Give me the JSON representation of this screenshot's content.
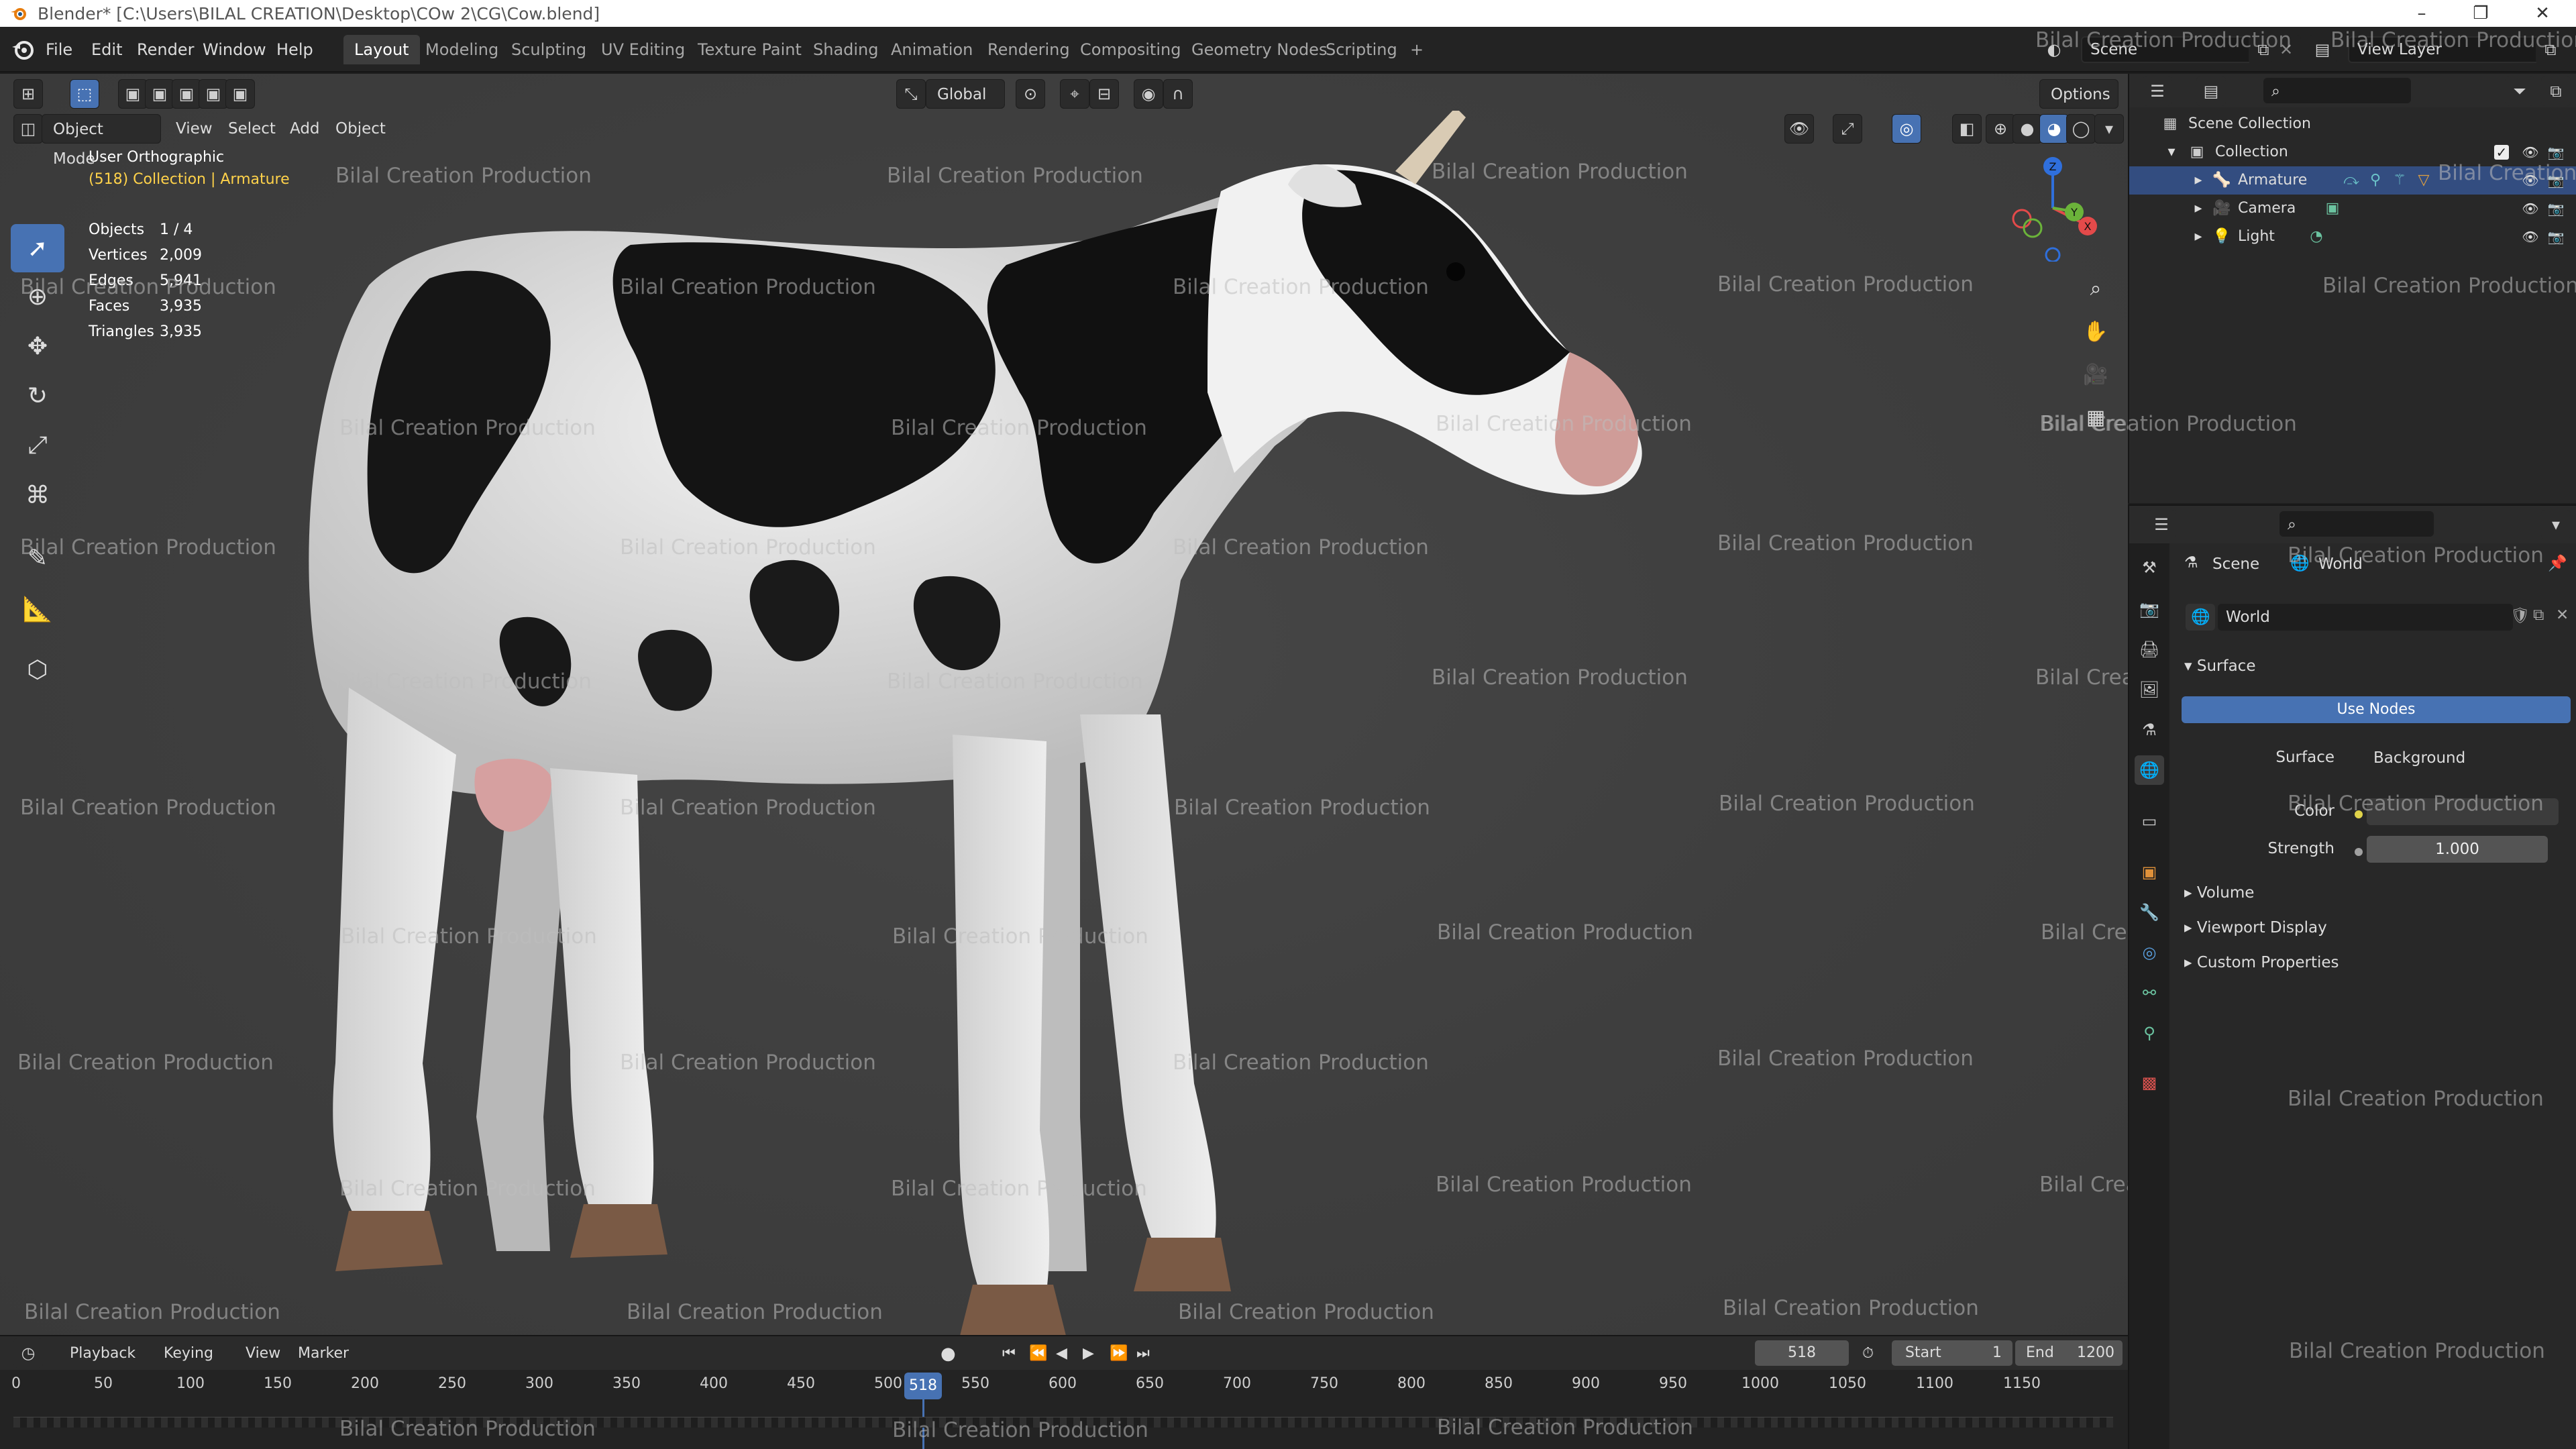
{
  "window": {
    "title": "Blender* [C:\\Users\\BILAL CREATION\\Desktop\\COw 2\\CG\\Cow.blend]",
    "controls": [
      "–",
      "❐",
      "✕"
    ]
  },
  "menu": {
    "items": [
      "File",
      "Edit",
      "Render",
      "Window",
      "Help"
    ],
    "workspaces": [
      "Layout",
      "Modeling",
      "Sculpting",
      "UV Editing",
      "Texture Paint",
      "Shading",
      "Animation",
      "Rendering",
      "Compositing",
      "Geometry Nodes",
      "Scripting"
    ],
    "active_workspace": "Layout",
    "add_tab": "+",
    "scene": "Scene",
    "view_layer": "View Layer"
  },
  "viewport": {
    "mode": "Object Mode",
    "menus": [
      "View",
      "Select",
      "Add",
      "Object"
    ],
    "transform_orientation": "Global",
    "options": "Options",
    "view_name": "User Orthographic",
    "context": "(518) Collection | Armature",
    "stats": [
      {
        "label": "Objects",
        "value": "1 / 4"
      },
      {
        "label": "Vertices",
        "value": "2,009"
      },
      {
        "label": "Edges",
        "value": "5,941"
      },
      {
        "label": "Faces",
        "value": "3,935"
      },
      {
        "label": "Triangles",
        "value": "3,935"
      }
    ],
    "gizmo_axes": {
      "x": "X",
      "y": "Y",
      "z": "Z"
    },
    "watermark": "Bilal Creation Production"
  },
  "timeline": {
    "menus": [
      "Playback",
      "Keying",
      "View",
      "Marker"
    ],
    "current_frame": "518",
    "start_label": "Start",
    "start": "1",
    "end_label": "End",
    "end": "1200",
    "ticks": [
      "0",
      "50",
      "100",
      "150",
      "200",
      "250",
      "300",
      "350",
      "400",
      "450",
      "500",
      "550",
      "600",
      "650",
      "700",
      "750",
      "800",
      "850",
      "900",
      "950",
      "1000",
      "1050",
      "1100",
      "1150"
    ]
  },
  "outliner": {
    "rows": [
      {
        "label": "Scene Collection",
        "icon": "scene-collection-icon"
      },
      {
        "label": "Collection",
        "icon": "collection-icon"
      },
      {
        "label": "Armature",
        "icon": "armature-icon",
        "selected": true
      },
      {
        "label": "Camera",
        "icon": "camera-icon"
      },
      {
        "label": "Light",
        "icon": "light-icon"
      }
    ]
  },
  "properties": {
    "breadcrumb": [
      "Scene",
      "World"
    ],
    "world_name": "World",
    "panel_surface": "Surface",
    "use_nodes": "Use Nodes",
    "surface_label": "Surface",
    "surface_value": "Background",
    "color_label": "Color",
    "strength_label": "Strength",
    "strength_value": "1.000",
    "collapsed_panels": [
      "Volume",
      "Viewport Display",
      "Custom Properties"
    ]
  },
  "colors": {
    "accent": "#4772b3",
    "selection": "#334d80",
    "context_text": "#ffd24a"
  }
}
